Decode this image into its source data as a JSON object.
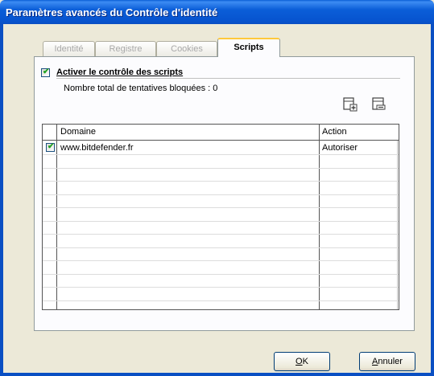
{
  "window": {
    "title": "Paramètres avancés du Contrôle d'identité"
  },
  "tabs": [
    {
      "label": "Identité",
      "active": false
    },
    {
      "label": "Registre",
      "active": false
    },
    {
      "label": "Cookies",
      "active": false
    },
    {
      "label": "Scripts",
      "active": true
    }
  ],
  "scripts": {
    "enable_label": "Activer le contrôle des scripts",
    "enable_checked": true,
    "blocked_count_text": "Nombre total de tentatives bloquées : 0"
  },
  "toolbar": {
    "icons": [
      "add-rule-icon",
      "edit-rule-icon"
    ]
  },
  "table": {
    "columns": [
      "Domaine",
      "Action"
    ],
    "rows": [
      {
        "checked": true,
        "domain": "www.bitdefender.fr",
        "action": "Autoriser"
      }
    ]
  },
  "buttons": {
    "ok_hotkey": "O",
    "ok_rest": "K",
    "cancel_hotkey": "A",
    "cancel_rest": "nnuler"
  },
  "colors": {
    "title_bar": "#0a5fd6",
    "dialog_bg": "#ece9d8",
    "active_tab_accent": "#ffc83c",
    "check_green": "#21a121"
  }
}
